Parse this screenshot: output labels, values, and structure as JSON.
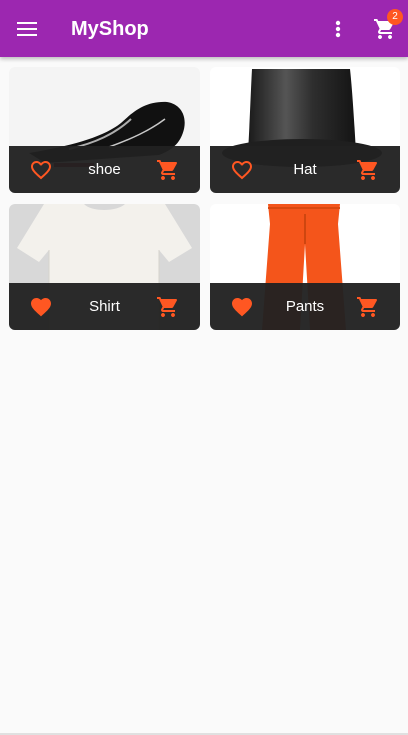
{
  "app": {
    "title": "MyShop",
    "cart_count": "2",
    "icons": {
      "menu": "menu-icon",
      "more": "more-vert-icon",
      "cart": "shopping-cart-icon"
    }
  },
  "colors": {
    "appbar": "#9c27b0",
    "accent": "#ff5722",
    "tile_footer": "#212121"
  },
  "products": [
    {
      "label": "shoe",
      "favorite": false
    },
    {
      "label": "Hat",
      "favorite": false
    },
    {
      "label": "Shirt",
      "favorite": true
    },
    {
      "label": "Pants",
      "favorite": true
    }
  ]
}
